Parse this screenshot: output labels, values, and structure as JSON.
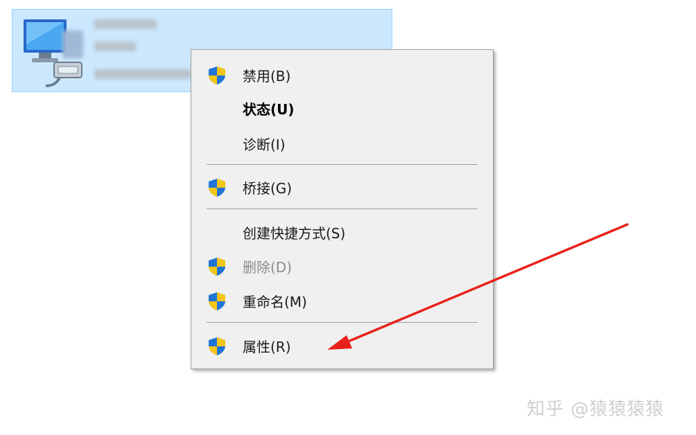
{
  "menu": {
    "items": [
      {
        "label": "禁用(B)",
        "shield": true
      },
      {
        "label": "状态(U)",
        "shield": false,
        "bold": true
      },
      {
        "label": "诊断(I)",
        "shield": false
      },
      {
        "label": "桥接(G)",
        "shield": true
      },
      {
        "label": "创建快捷方式(S)",
        "shield": false
      },
      {
        "label": "删除(D)",
        "shield": true,
        "disabled": true
      },
      {
        "label": "重命名(M)",
        "shield": true
      },
      {
        "label": "属性(R)",
        "shield": true
      }
    ]
  },
  "watermark": "知乎 @猿猿猿猿",
  "colors": {
    "selection_bg": "#cce8ff",
    "menu_bg": "#f0f0f0",
    "arrow": "#e8211c",
    "shield_blue": "#1f74d6",
    "shield_yellow": "#f5c518"
  }
}
